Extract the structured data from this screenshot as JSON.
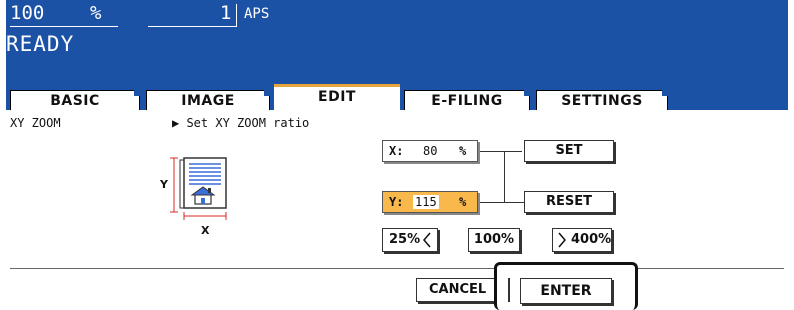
{
  "status": {
    "zoom_value": "100",
    "zoom_unit": "%",
    "copies": "1",
    "paper": "APS",
    "state": "READY"
  },
  "tabs": [
    {
      "label": "BASIC"
    },
    {
      "label": "IMAGE"
    },
    {
      "label": "EDIT"
    },
    {
      "label": "E-FILING"
    },
    {
      "label": "SETTINGS"
    }
  ],
  "active_tab": "EDIT",
  "panel": {
    "section_title": "XY ZOOM",
    "instruction": "▶ Set XY ZOOM ratio",
    "diagram": {
      "y_label": "Y",
      "x_label": "X"
    },
    "x_field": {
      "label": "X:",
      "value": "80",
      "unit": "%"
    },
    "y_field": {
      "label": "Y:",
      "value": "115",
      "unit": "%"
    },
    "set_label": "SET",
    "reset_label": "RESET",
    "preset_25": "25%",
    "preset_100": "100%",
    "preset_400": "400%",
    "cancel_label": "CANCEL",
    "enter_label": "ENTER"
  },
  "colors": {
    "header_blue": "#1c52a6",
    "selected_field": "#f8b84c",
    "active_tab_accent": "#e8a53c"
  },
  "icons": [
    "document-icon",
    "house-icon",
    "chevron-left-icon",
    "chevron-right-icon"
  ]
}
